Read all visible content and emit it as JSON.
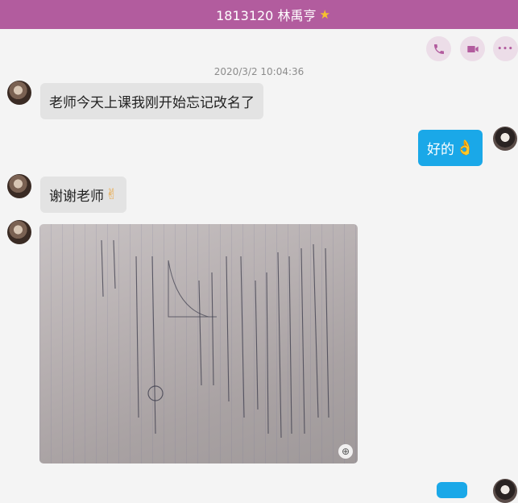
{
  "header": {
    "title": "1813120 林禹亨",
    "star_icon": "star-icon"
  },
  "actions": {
    "phone_icon": "phone-icon",
    "video_icon": "video-icon",
    "more_icon": "more-icon",
    "more_glyph": "•••"
  },
  "chat": {
    "timestamp": "2020/3/2 10:04:36",
    "messages": [
      {
        "side": "in",
        "text": "老师今天上课我刚开始忘记改名了"
      },
      {
        "side": "out",
        "text": "好的",
        "emoji": "👌"
      },
      {
        "side": "in",
        "text": "谢谢老师",
        "emoji": "✌"
      },
      {
        "side": "in",
        "type": "image",
        "description_icon": "photo-icon"
      }
    ]
  },
  "colors": {
    "header_bg": "#b25c9e",
    "bubble_in": "#e3e3e3",
    "bubble_out": "#1aa8e8"
  }
}
